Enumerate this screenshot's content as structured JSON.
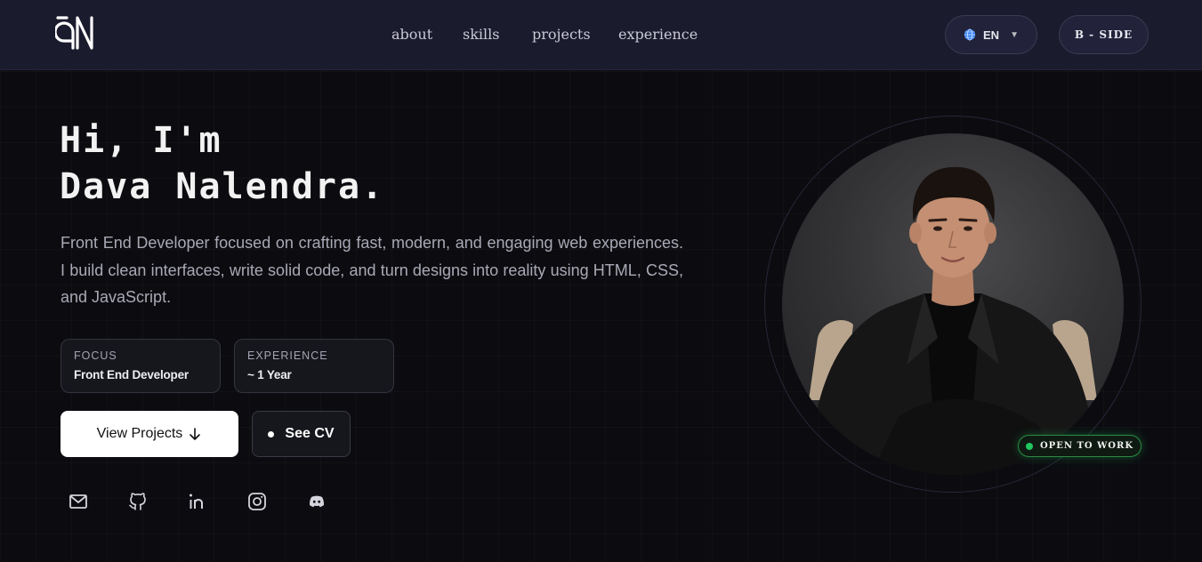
{
  "nav": {
    "logo_text": "DN",
    "links": [
      {
        "label": "about"
      },
      {
        "label": "skills"
      },
      {
        "label": "projects"
      },
      {
        "label": "experience"
      }
    ],
    "language": {
      "label": "EN",
      "icon": "globe-icon"
    },
    "side_button": "B - SIDE"
  },
  "hero": {
    "greeting": "Hi, I'm",
    "name": "Dava Nalendra.",
    "description": "Front End Developer focused on crafting fast, modern, and engaging web experiences. I build clean interfaces, write solid code, and turn designs into reality using HTML, CSS, and JavaScript.",
    "cards": [
      {
        "label": "FOCUS",
        "value": "Front End Developer"
      },
      {
        "label": "EXPERIENCE",
        "value": "~ 1 Year"
      }
    ],
    "primary_button": "View Projects",
    "secondary_button": "See CV",
    "socials": [
      "mail-icon",
      "github-icon",
      "linkedin-icon",
      "instagram-icon",
      "discord-icon"
    ]
  },
  "portrait": {
    "badge": "OPEN TO WORK",
    "badge_color": "#22c55e"
  },
  "colors": {
    "background": "#0c0c10",
    "navbar": "#1b1b2e",
    "text_muted": "#a9a9b6"
  }
}
